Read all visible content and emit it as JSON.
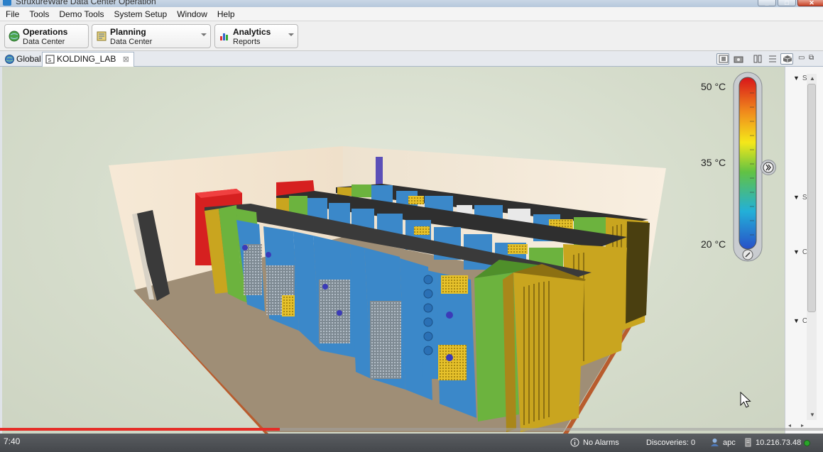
{
  "window": {
    "title": "StruxureWare Data Center Operation"
  },
  "menu": {
    "items": [
      "File",
      "Tools",
      "Demo Tools",
      "System Setup",
      "Window",
      "Help"
    ]
  },
  "perspectives": [
    {
      "title": "Operations",
      "subtitle": "Data Center"
    },
    {
      "title": "Planning",
      "subtitle": "Data Center"
    },
    {
      "title": "Analytics",
      "subtitle": "Reports"
    }
  ],
  "tabs": [
    {
      "label": "Global"
    },
    {
      "label": "KOLDING_LAB",
      "close": "⊠"
    }
  ],
  "temperature_legend": {
    "labels": [
      "50 °C",
      "35 °C",
      "20 °C"
    ],
    "colors": [
      "#d8141a",
      "#f08a1c",
      "#f4e81a",
      "#62c243",
      "#23b0d8",
      "#2850c8"
    ],
    "expand_icon": "double-chevron-right-icon"
  },
  "side_panel": {
    "markers": [
      "S",
      "S",
      "C",
      "C"
    ]
  },
  "video": {
    "timestamp": "7:40",
    "progress": 0.34
  },
  "status": {
    "alarms": "No Alarms",
    "discoveries": "Discoveries: 0",
    "user": "apc",
    "server": "10.216.73.48",
    "connection_color": "#2aa52a"
  },
  "colors": {
    "rack_blue": "#3b88c9",
    "rack_green": "#6cb33e",
    "rack_yellow": "#c9a51f",
    "rack_red": "#d62020",
    "rack_top": "#3a3a3a"
  }
}
